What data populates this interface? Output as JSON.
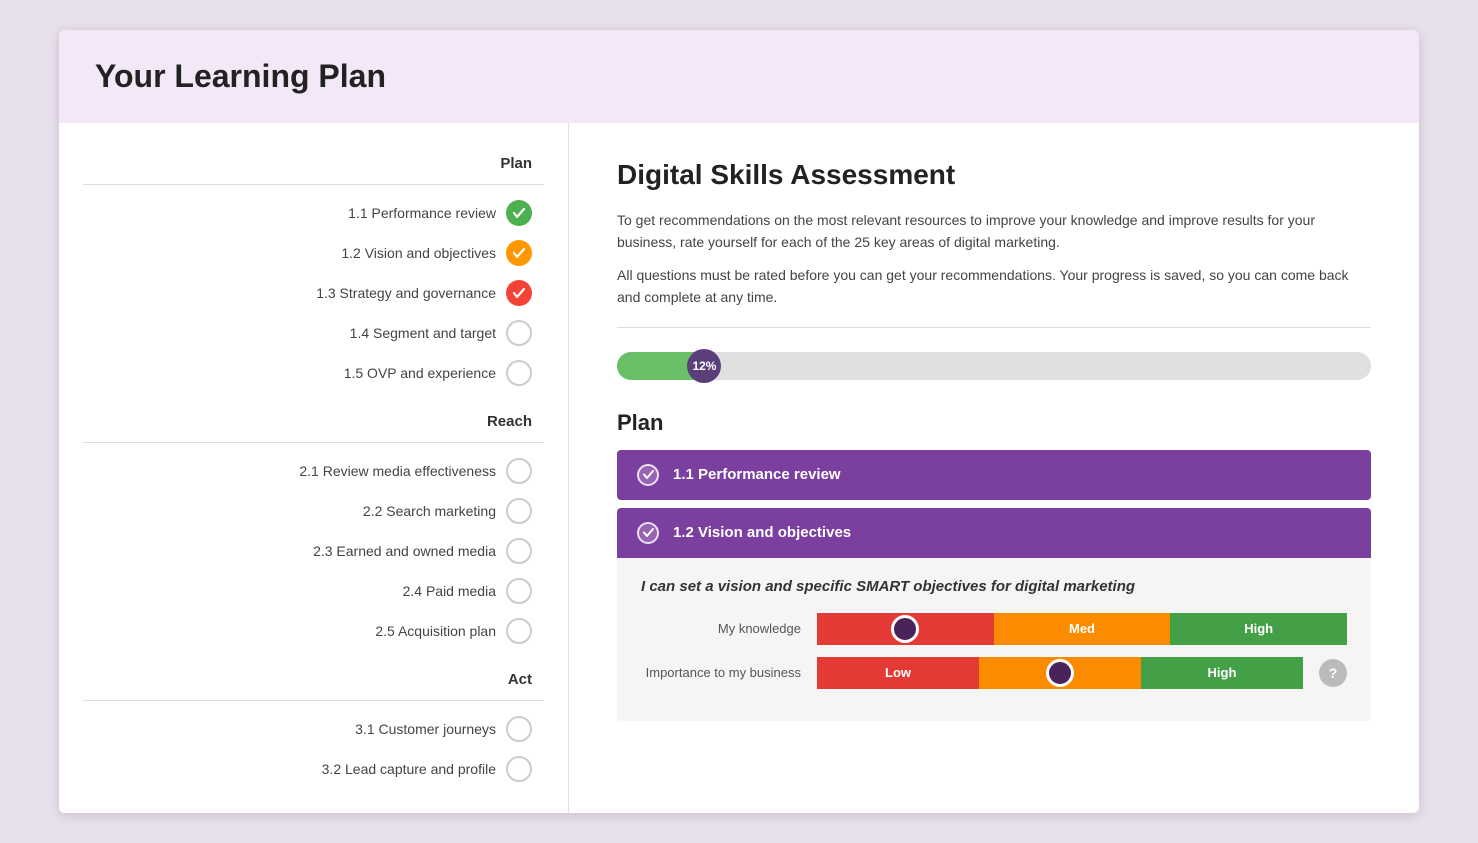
{
  "header": {
    "title": "Your Learning Plan"
  },
  "main": {
    "title": "Digital Skills Assessment",
    "intro1": "To get recommendations on the most relevant resources to improve your knowledge and improve results for your business, rate yourself for each of the 25 key areas of digital marketing.",
    "intro2": "All questions must be rated before you can get your recommendations. Your progress is saved, so you can come back and complete at any time.",
    "progress_percent": 12,
    "progress_label": "12%",
    "section_plan_label": "Plan",
    "section_reach_label": "Reach",
    "section_act_label": "Act"
  },
  "sidebar": {
    "sections": [
      {
        "label": "Plan",
        "items": [
          {
            "id": "1.1",
            "label": "1.1 Performance review",
            "status": "green"
          },
          {
            "id": "1.2",
            "label": "1.2 Vision and objectives",
            "status": "orange"
          },
          {
            "id": "1.3",
            "label": "1.3 Strategy and governance",
            "status": "red"
          },
          {
            "id": "1.4",
            "label": "1.4 Segment and target",
            "status": "empty"
          },
          {
            "id": "1.5",
            "label": "1.5 OVP and experience",
            "status": "empty"
          }
        ]
      },
      {
        "label": "Reach",
        "items": [
          {
            "id": "2.1",
            "label": "2.1 Review media effectiveness",
            "status": "empty"
          },
          {
            "id": "2.2",
            "label": "2.2 Search marketing",
            "status": "empty"
          },
          {
            "id": "2.3",
            "label": "2.3 Earned and owned media",
            "status": "empty"
          },
          {
            "id": "2.4",
            "label": "2.4 Paid media",
            "status": "empty"
          },
          {
            "id": "2.5",
            "label": "2.5 Acquisition plan",
            "status": "empty"
          }
        ]
      },
      {
        "label": "Act",
        "items": [
          {
            "id": "3.1",
            "label": "3.1 Customer journeys",
            "status": "empty"
          },
          {
            "id": "3.2",
            "label": "3.2 Lead capture and profile",
            "status": "empty"
          }
        ]
      }
    ]
  },
  "accordions": [
    {
      "id": "1.1",
      "label": "1.1 Performance review",
      "checked": true,
      "expanded": false
    },
    {
      "id": "1.2",
      "label": "1.2 Vision and objectives",
      "checked": true,
      "expanded": true,
      "question": "I can set a vision and specific SMART objectives for digital marketing",
      "ratings": [
        {
          "label": "My knowledge",
          "segments": [
            "Low",
            "Med",
            "High"
          ],
          "selected": 0
        },
        {
          "label": "Importance to my business",
          "segments": [
            "Low",
            "Med",
            "High"
          ],
          "selected": 1
        }
      ]
    }
  ],
  "icons": {
    "checkmark": "✓",
    "question": "?"
  }
}
